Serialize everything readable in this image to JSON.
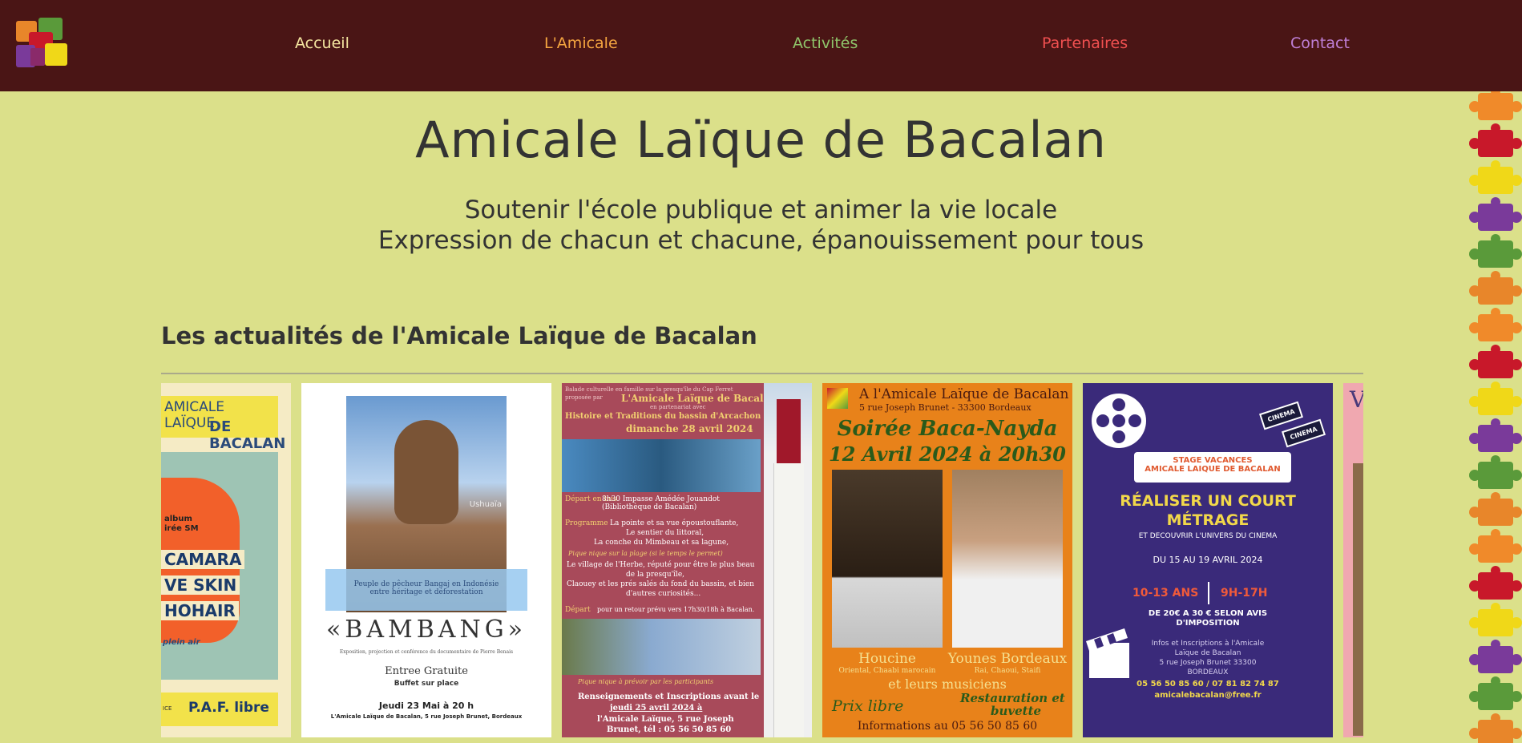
{
  "nav": {
    "items": [
      {
        "label": "Accueil",
        "color": "#f5e6a0"
      },
      {
        "label": "L'Amicale",
        "color": "#f5a540"
      },
      {
        "label": "Activités",
        "color": "#8fc46a"
      },
      {
        "label": "Partenaires",
        "color": "#f05050"
      },
      {
        "label": "Contact",
        "color": "#c080d8"
      }
    ]
  },
  "hero": {
    "title": "Amicale Laïque de Bacalan",
    "tagline_1": "Soutenir l'école publique et animer la vie locale",
    "tagline_2": "Expression de chacun et chacune, épanouissement pour tous"
  },
  "news": {
    "heading": "Les actualités de l'Amicale Laïque de Bacalan"
  },
  "posters": {
    "p1": {
      "header_1": "AMICALE LAÏQUE",
      "header_2": "DE BACALAN",
      "line_a": "album",
      "line_b": "irée SM",
      "name_1": "CAMARA",
      "name_2": "VE SKIN",
      "name_3": "HOHAIR",
      "note": "plein air",
      "footer": "P.A.F. libre",
      "footer_left": "ICE"
    },
    "p2": {
      "watermark": "Ushuaïa",
      "caption_1": "Peuple de pêcheur Bangaj en Indonésie",
      "caption_2": "entre héritage et déforestation",
      "title": "«BAMBANG»",
      "subtitle": "Exposition, projection et conférence du documentaire de Pierre Benais",
      "entry": "Entree Gratuite",
      "buffet": "Buffet sur place",
      "date": "Jeudi 23 Mai à 20 h",
      "address": "L'Amicale Laïque de Bacalan, 5 rue Joseph Brunet, Bordeaux"
    },
    "p3": {
      "intro_1": "Balade culturelle en famille sur la presqu'île du Cap Ferret",
      "intro_2": "proposée par",
      "org": "L'Amicale Laïque de Bacalan",
      "partner": "en partenariat avec",
      "assoc": "Histoire et Traditions du bassin d'Arcachon",
      "date": "dimanche 28 avril 2024",
      "depart_label": "Départ en bus",
      "depart_text": "8h30 Impasse Amédée Jouandot (Bibliothèque de Bacalan)",
      "prog_label": "Programme",
      "prog_1": "La pointe et sa vue époustouflante,",
      "prog_2": "Le sentier du littoral,",
      "prog_3": "La conche du Mimbeau et sa lagune,",
      "picnic": "Pique nique sur la plage (si le temps le permet)",
      "village_1": "Le village de l'Herbe, réputé pour être le plus beau",
      "village_2": "de la presqu'île,",
      "village_3": "Claouey et les prés salés du fond du bassin, et bien",
      "village_4": "d'autres curiosités...",
      "return_label": "Départ",
      "return_text": "pour un retour prévu vers 17h30/18h à Bacalan.",
      "picnic_note": "Pique nique à prévoir par les participants",
      "info_1": "Renseignements et Inscriptions avant le",
      "info_2": "jeudi 25 avril 2024 à",
      "info_3": "l'Amicale Laïque, 5 rue Joseph",
      "info_4": "Brunet, tél : 05 56 50 85 60"
    },
    "p4": {
      "header": "A l'Amicale Laïque de Bacalan",
      "address": "5 rue Joseph Brunet - 33300 Bordeaux",
      "event_1": "Soirée Baca-Nayda",
      "event_2": "12 Avril 2024 à 20h30",
      "artist_1": "Houcine",
      "genre_1": "Oriental, Chaabi marocain",
      "artist_2": "Younes Bordeaux",
      "genre_2": "Rai, Chaoui, Staifi",
      "musicians": "et leurs musiciens",
      "price": "Prix libre",
      "bar_1": "Restauration et",
      "bar_2": "buvette",
      "info": "Informations au 05 56 50 85 60"
    },
    "p5": {
      "badge": "CINEMA",
      "badge_2": "CINEMA",
      "banner_1": "STAGE VACANCES",
      "banner_2": "AMICALE LAIQUE DE BACALAN",
      "title_1": "RÉALISER UN COURT",
      "title_2": "MÉTRAGE",
      "subtitle": "ET DECOUVRIR L'UNIVERS DU CINEMA",
      "dates": "DU 15 AU 19 AVRIL 2024",
      "ages": "10-13 ANS",
      "hours": "9H-17H",
      "price_1": "DE 20€ A 30 € SELON AVIS",
      "price_2": "D'IMPOSITION",
      "info_1": "Infos et Inscriptions à l'Amicale",
      "info_2": "Laïque de Bacalan",
      "info_3": "5 rue Joseph Brunet 33300",
      "info_4": "BORDEAUX",
      "phone": "05 56 50 85 60 / 07 81 82 74 87",
      "email": "amicalebacalan@free.fr"
    },
    "p6": {
      "letter": "V"
    }
  },
  "colors": {
    "header_bg": "#4a1515",
    "page_bg": "#dbe08a",
    "text": "#333333"
  },
  "icons": [
    "logo-puzzle",
    "film-reel-icon",
    "clapperboard-icon",
    "puzzle-border"
  ]
}
